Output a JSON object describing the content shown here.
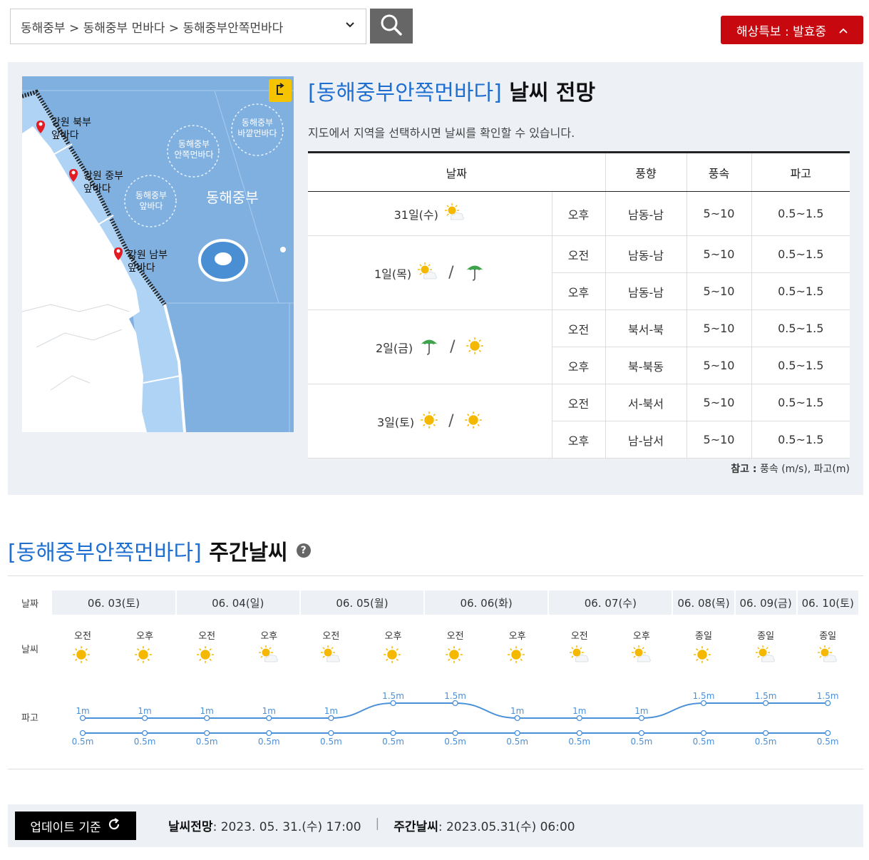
{
  "search": {
    "breadcrumb": "동해중부 > 동해중부 먼바다 > 동해중부안쪽먼바다"
  },
  "alert": {
    "label": "해상특보 : 발효중"
  },
  "map": {
    "labels": {
      "north": [
        "강원 북부",
        "앞바다"
      ],
      "middle": [
        "강원 중부",
        "앞바다"
      ],
      "south": [
        "강원 남부",
        "앞바다"
      ],
      "inner": [
        "동해중부",
        "안쪽먼바다"
      ],
      "outer": [
        "동해중부",
        "바깥먼바다"
      ],
      "near": [
        "동해중부",
        "앞바다"
      ],
      "region": "동해중부"
    }
  },
  "forecast": {
    "title_region": "[동해중부안쪽먼바다]",
    "title_suffix": " 날씨 전망",
    "description": "지도에서 지역을 선택하시면 날씨를 확인할 수 있습니다.",
    "headers": [
      "날짜",
      "풍향",
      "풍속",
      "파고"
    ],
    "days": [
      {
        "date": "31일(수)",
        "icons": [
          "partly-cloudy"
        ],
        "rows": [
          {
            "period": "오후",
            "direction": "남동-남",
            "speed": "5~10",
            "wave": "0.5~1.5"
          }
        ]
      },
      {
        "date": "1일(목)",
        "icons": [
          "partly-cloudy",
          "umbrella"
        ],
        "rows": [
          {
            "period": "오전",
            "direction": "남동-남",
            "speed": "5~10",
            "wave": "0.5~1.5"
          },
          {
            "period": "오후",
            "direction": "남동-남",
            "speed": "5~10",
            "wave": "0.5~1.5"
          }
        ]
      },
      {
        "date": "2일(금)",
        "icons": [
          "umbrella",
          "sunny"
        ],
        "rows": [
          {
            "period": "오전",
            "direction": "북서-북",
            "speed": "5~10",
            "wave": "0.5~1.5"
          },
          {
            "period": "오후",
            "direction": "북-북동",
            "speed": "5~10",
            "wave": "0.5~1.5"
          }
        ]
      },
      {
        "date": "3일(토)",
        "icons": [
          "sunny",
          "sunny"
        ],
        "rows": [
          {
            "period": "오전",
            "direction": "서-북서",
            "speed": "5~10",
            "wave": "0.5~1.5"
          },
          {
            "period": "오후",
            "direction": "남-남서",
            "speed": "5~10",
            "wave": "0.5~1.5"
          }
        ]
      }
    ],
    "note_label": "참고 :",
    "note_text": " 풍속 (m/s), 파고(m)"
  },
  "weekly": {
    "title_region": "[동해중부안쪽먼바다]",
    "title_suffix": " 주간날씨",
    "help_icon": "?",
    "row_labels": {
      "date": "날짜",
      "weather": "날씨",
      "wave": "파고"
    },
    "dates": [
      "06. 03(토)",
      "06. 04(일)",
      "06. 05(월)",
      "06. 06(화)",
      "06. 07(수)",
      "06. 08(목)",
      "06. 09(금)",
      "06. 10(토)"
    ],
    "slots": [
      {
        "period": "오전",
        "icon": "sunny",
        "high": 1,
        "high_label": "1m",
        "low": 0.5,
        "low_label": "0.5m"
      },
      {
        "period": "오후",
        "icon": "sunny",
        "high": 1,
        "high_label": "1m",
        "low": 0.5,
        "low_label": "0.5m"
      },
      {
        "period": "오전",
        "icon": "sunny",
        "high": 1,
        "high_label": "1m",
        "low": 0.5,
        "low_label": "0.5m"
      },
      {
        "period": "오후",
        "icon": "partly-cloudy",
        "high": 1,
        "high_label": "1m",
        "low": 0.5,
        "low_label": "0.5m"
      },
      {
        "period": "오전",
        "icon": "partly-cloudy",
        "high": 1,
        "high_label": "1m",
        "low": 0.5,
        "low_label": "0.5m"
      },
      {
        "period": "오후",
        "icon": "sunny",
        "high": 1.5,
        "high_label": "1.5m",
        "low": 0.5,
        "low_label": "0.5m"
      },
      {
        "period": "오전",
        "icon": "sunny",
        "high": 1.5,
        "high_label": "1.5m",
        "low": 0.5,
        "low_label": "0.5m"
      },
      {
        "period": "오후",
        "icon": "sunny",
        "high": 1,
        "high_label": "1m",
        "low": 0.5,
        "low_label": "0.5m"
      },
      {
        "period": "오전",
        "icon": "partly-cloudy",
        "high": 1,
        "high_label": "1m",
        "low": 0.5,
        "low_label": "0.5m"
      },
      {
        "period": "오후",
        "icon": "partly-cloudy",
        "high": 1,
        "high_label": "1m",
        "low": 0.5,
        "low_label": "0.5m"
      },
      {
        "period": "종일",
        "icon": "sunny",
        "high": 1.5,
        "high_label": "1.5m",
        "low": 0.5,
        "low_label": "0.5m"
      },
      {
        "period": "종일",
        "icon": "partly-cloudy",
        "high": 1.5,
        "high_label": "1.5m",
        "low": 0.5,
        "low_label": "0.5m"
      },
      {
        "period": "종일",
        "icon": "partly-cloudy",
        "high": 1.5,
        "high_label": "1.5m",
        "low": 0.5,
        "low_label": "0.5m"
      }
    ]
  },
  "footer": {
    "update_label": "업데이트 기준",
    "forecast_label": "날씨전망",
    "forecast_time": " : 2023. 05. 31.(수) 17:00",
    "separator": "|",
    "weekly_label": "주간날씨",
    "weekly_time": " : 2023.05.31(수) 06:00"
  },
  "colors": {
    "accent_blue": "#1f6fd1",
    "alert_red": "#c8080f",
    "wave_line": "#4a90d9",
    "sun": "#f5b800"
  }
}
